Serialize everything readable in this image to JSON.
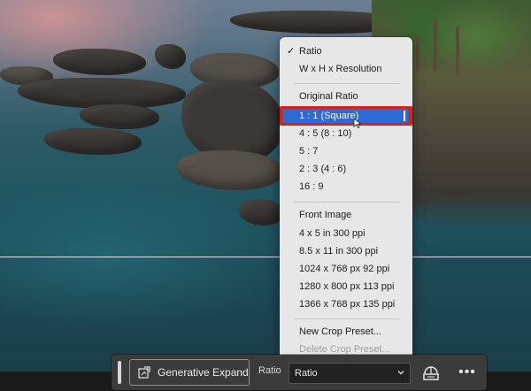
{
  "menu": {
    "items": [
      {
        "label": "Ratio",
        "checked": true
      },
      {
        "label": "W x H x Resolution"
      },
      {
        "label": "Original Ratio"
      },
      {
        "label": "1 : 1 (Square)",
        "selected": true
      },
      {
        "label": "4 : 5 (8 : 10)"
      },
      {
        "label": "5 : 7"
      },
      {
        "label": "2 : 3 (4 : 6)"
      },
      {
        "label": "16 : 9"
      },
      {
        "label": "Front Image"
      },
      {
        "label": "4 x 5 in 300 ppi"
      },
      {
        "label": "8.5 x 11 in 300 ppi"
      },
      {
        "label": "1024 x 768 px 92 ppi"
      },
      {
        "label": "1280 x 800 px 113 ppi"
      },
      {
        "label": "1366 x 768 px 135 ppi"
      },
      {
        "label": "New Crop Preset..."
      },
      {
        "label": "Delete Crop Preset...",
        "disabled": true
      }
    ],
    "check_glyph": "✓"
  },
  "toolbar": {
    "generative_expand_label": "Generative Expand",
    "ratio_label": "Ratio",
    "ratio_value": "Ratio",
    "more_glyph": "•••"
  },
  "colors": {
    "selection_highlight": "#2d6bd3",
    "annotation_box": "#d0241d",
    "menu_background": "#e7e7e7",
    "toolbar_background": "#3b3b3b"
  },
  "icons": {
    "generative_expand": "generative-expand-icon",
    "dropdown_chevron": "chevron-down-icon",
    "straighten_tool": "straighten-icon",
    "more_options": "more-icon",
    "cursor": "mouse-cursor-icon"
  }
}
